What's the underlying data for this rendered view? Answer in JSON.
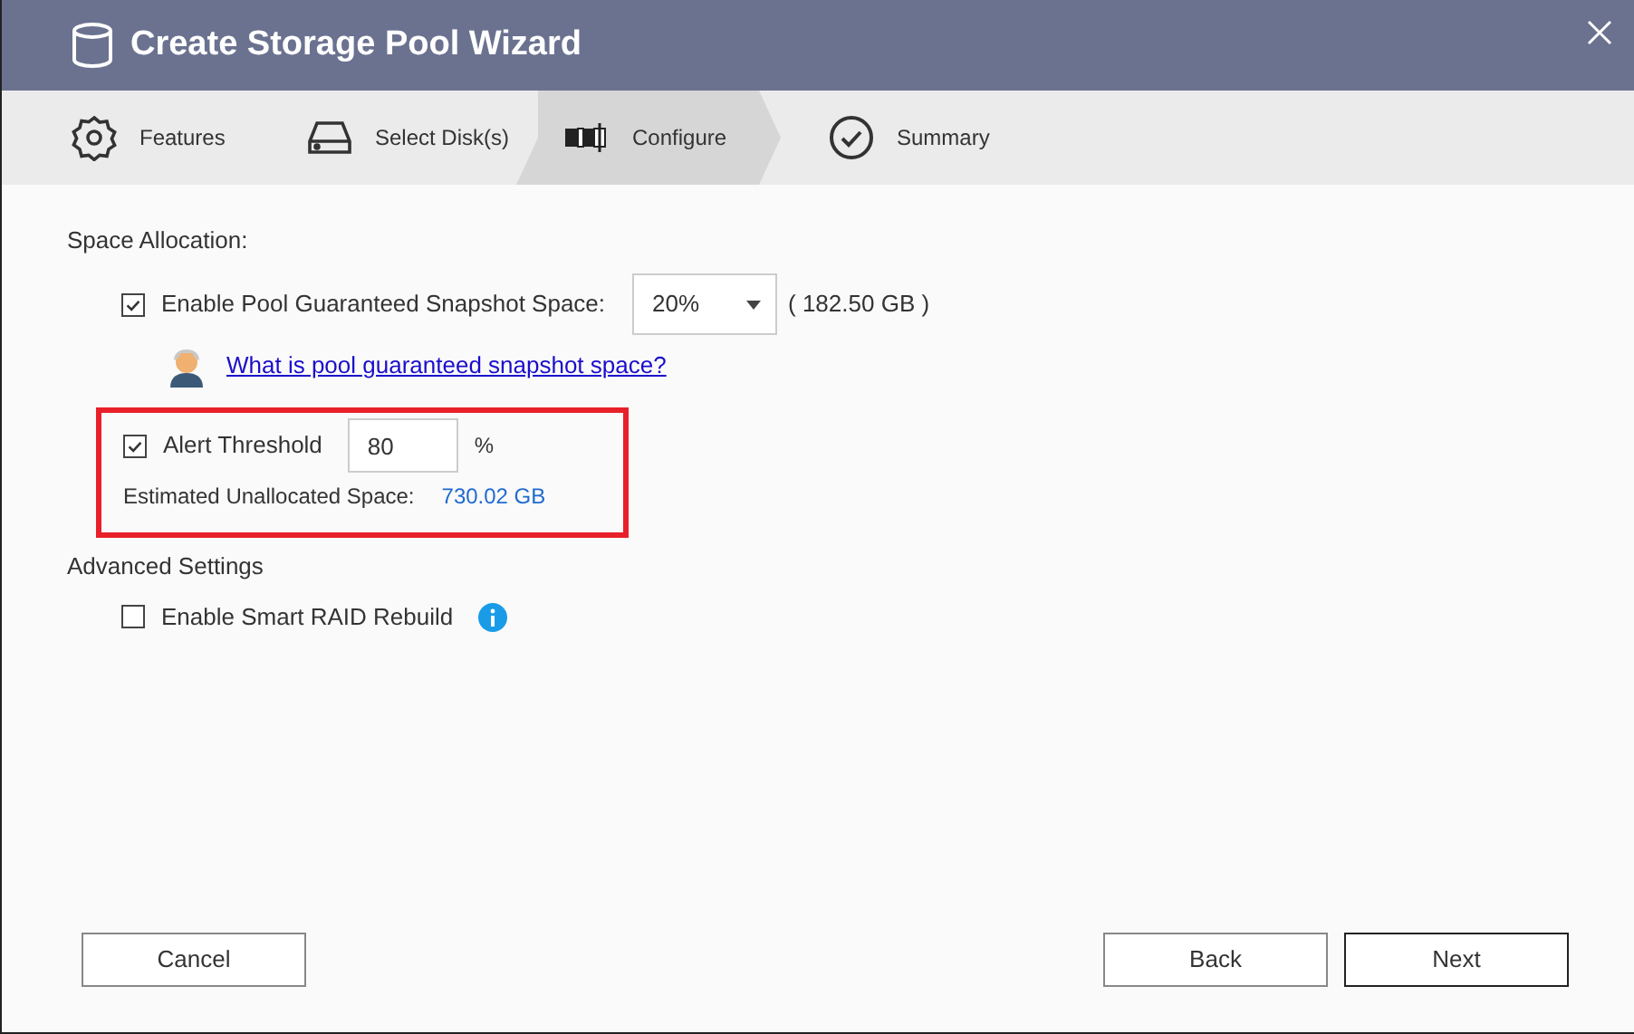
{
  "window": {
    "title": "Create Storage Pool Wizard"
  },
  "steps": [
    {
      "label": "Features",
      "kind": "gear",
      "selected": false
    },
    {
      "label": "Select Disk(s)",
      "kind": "disk",
      "selected": false
    },
    {
      "label": "Configure",
      "kind": "config",
      "selected": true
    },
    {
      "label": "Summary",
      "kind": "check",
      "selected": false
    }
  ],
  "space_allocation": {
    "heading": "Space Allocation:",
    "snapshot": {
      "label": "Enable Pool Guaranteed Snapshot Space:",
      "checked": true,
      "value": "20%",
      "size": "( 182.50 GB )"
    },
    "help_link": "What is pool guaranteed snapshot space?",
    "alert": {
      "label": "Alert Threshold",
      "checked": true,
      "value": "80",
      "unit": "%"
    },
    "estimate": {
      "label": "Estimated Unallocated Space:",
      "value": "730.02 GB"
    }
  },
  "advanced": {
    "heading": "Advanced Settings",
    "smart_raid": {
      "label": "Enable Smart RAID Rebuild",
      "checked": false
    }
  },
  "buttons": [
    {
      "label": "Cancel",
      "kind": "cancel",
      "focused": false
    },
    {
      "label": "Back",
      "kind": "nav",
      "focused": false
    },
    {
      "label": "Next",
      "kind": "nav",
      "focused": true
    }
  ]
}
